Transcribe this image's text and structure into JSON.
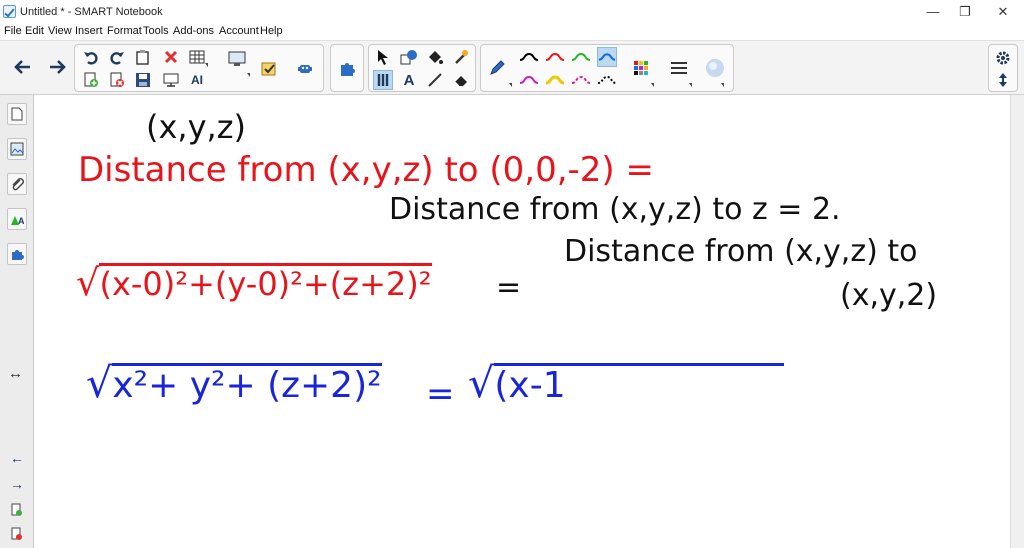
{
  "window": {
    "title": "Untitled * - SMART Notebook",
    "minimize_glyph": "—",
    "maximize_glyph": "❐",
    "close_glyph": "✕"
  },
  "menu": [
    "File",
    "Edit",
    "View",
    "Insert",
    "Format",
    "Tools",
    "Add-ons",
    "Account",
    "Help"
  ],
  "toolbar": {
    "icons": [
      "back-arrow-icon",
      "forward-arrow-icon",
      "undo-icon",
      "redo-icon",
      "paste-icon",
      "delete-icon",
      "table-icon",
      "add-page-icon",
      "save-icon",
      "screen-shade-icon",
      "handwriting-recognition-icon",
      "document-camera-icon",
      "response-icon",
      "add-ons-icon",
      "extensions-icon",
      "select-icon",
      "shapes-icon",
      "fill-icon",
      "magic-pen-icon",
      "text-icon",
      "line-icon",
      "eraser-icon",
      "pen-icon",
      "pen-style-icons",
      "color-palette-icon",
      "line-style-icon",
      "fill-effects-icon",
      "settings-gear-icon",
      "move-toolbar-icon"
    ],
    "pen_colors": [
      "#000000",
      "#e8141c",
      "#28b428",
      "#1a6fd8",
      "#c81ec8",
      "#f0c800",
      "#e61e8c",
      "#000000"
    ],
    "text_tool_glyph": "A",
    "handwriting_glyph": "AI"
  },
  "sidebar": {
    "icons": [
      "page-sorter-icon",
      "gallery-icon",
      "attachments-icon",
      "properties-icon",
      "add-ons-tab-icon",
      "resize-sidebar-icon",
      "previous-page-icon",
      "next-page-icon",
      "page-icon",
      "delete-page-icon"
    ],
    "resize_glyph": "↔",
    "prev_glyph": "←",
    "next_glyph": "→"
  },
  "canvas": {
    "colors": {
      "black": "#111111",
      "red": "#e8141c",
      "blue": "#1826d8"
    },
    "ink": {
      "point_label": "(x,y,z)",
      "red_line1": "Distance from (x,y,z) to (0,0,-2) =",
      "black_line1": "Distance from (x,y,z) to z = 2.",
      "black_line2": "Distance from (x,y,z) to",
      "black_line3": "(x,y,2)",
      "red_sqrt": "(x-0)²+(y-0)²+(z+2)²",
      "red_equals": "=",
      "blue_left": "x²+ y²+ (z+2)²",
      "blue_equals": "=",
      "blue_right": "(x-1"
    }
  }
}
